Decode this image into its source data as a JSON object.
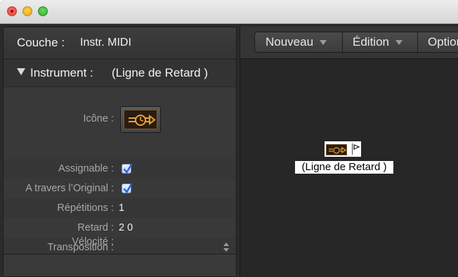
{
  "window": {
    "controls": [
      "close",
      "minimize",
      "zoom"
    ]
  },
  "inspector": {
    "layer_label": "Couche :",
    "layer_value": "Instr. MIDI",
    "section_title": "Instrument :",
    "section_value": "(Ligne de Retard )",
    "params": {
      "icon_label": "Icône :",
      "assignable_label": "Assignable :",
      "through_label": "A travers l’Original :",
      "repetitions_label": "Répétitions :",
      "repetitions_value": "1",
      "delay_label": "Retard :",
      "delay_value": "2 0",
      "transposition_label": "Transposition :",
      "velocity_label": "Vélocité :"
    },
    "assignable_checked": true,
    "through_checked": true
  },
  "toolbar": {
    "new_label": "Nouveau",
    "edit_label": "Édition",
    "options_label": "Options"
  },
  "canvas": {
    "object_label": "(Ligne de Retard )"
  },
  "colors": {
    "window_bg": "#2b2b2b",
    "icon_orange": "#e8a23a",
    "checkbox_blue": "#2b63d6"
  },
  "icons": {
    "delay_line": "clock-arrow-icon",
    "disclosure": "triangle-down-icon",
    "menu_arrow": "chevron-down-icon"
  }
}
